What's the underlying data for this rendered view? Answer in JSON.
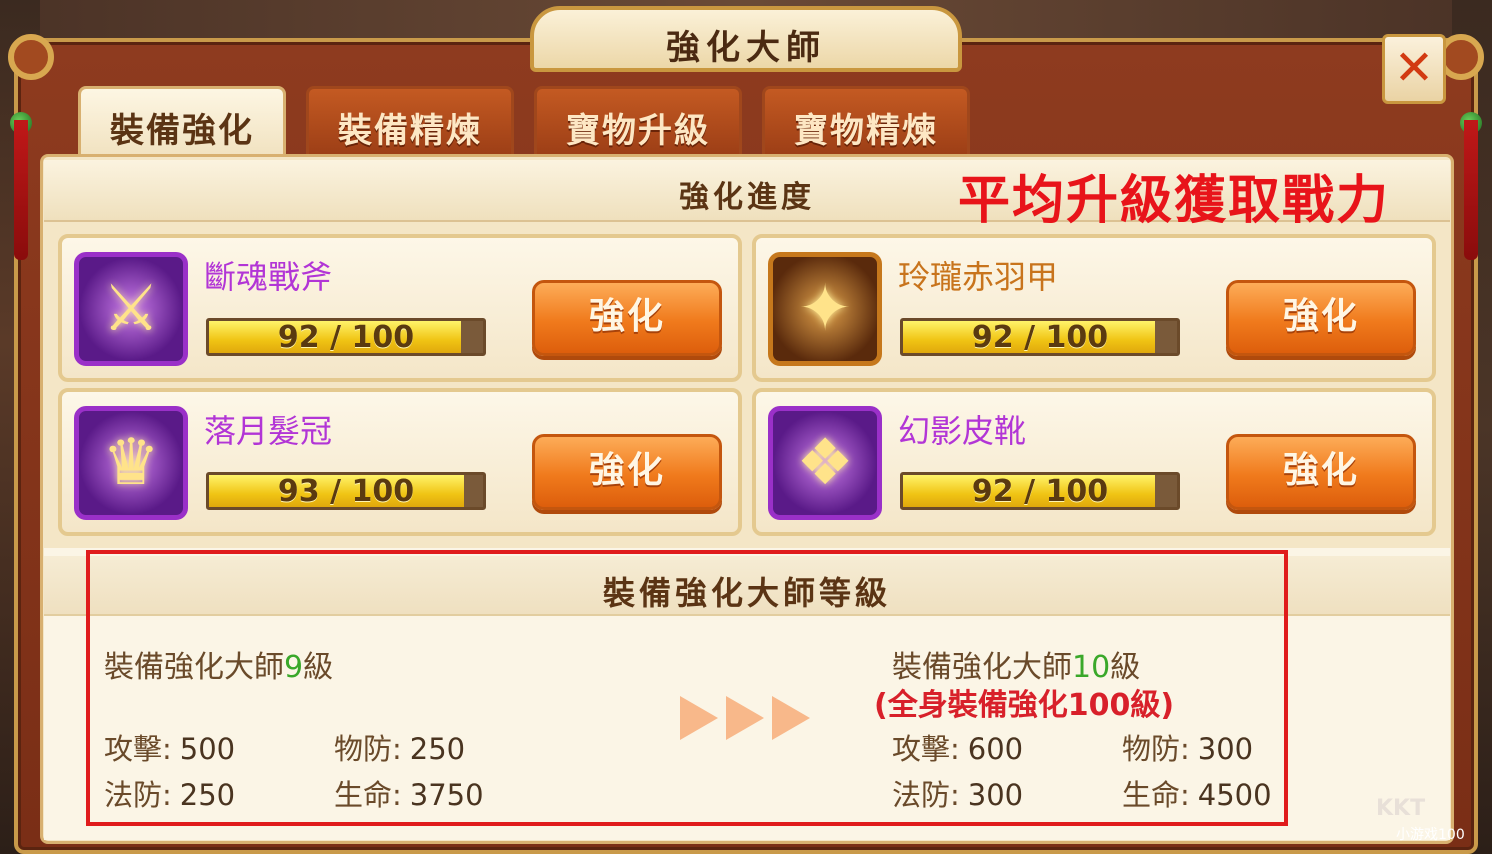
{
  "window_title": "強化大師",
  "close_label": "✕",
  "tabs": [
    {
      "label": "裝備強化",
      "active": true
    },
    {
      "label": "裝備精煉",
      "active": false
    },
    {
      "label": "寶物升級",
      "active": false
    },
    {
      "label": "寶物精煉",
      "active": false
    }
  ],
  "progress_section": {
    "title": "強化進度",
    "annotation": "平均升級獲取戰力"
  },
  "equipment": [
    {
      "name": "斷魂戰斧",
      "progress_text": "92 / 100",
      "progress": 0.92,
      "button": "強化",
      "icon": "axe-icon",
      "rarity_color": "#b235d6"
    },
    {
      "name": "玲瓏赤羽甲",
      "progress_text": "92 / 100",
      "progress": 0.92,
      "button": "強化",
      "icon": "armor-icon",
      "rarity_color": "#c8741c"
    },
    {
      "name": "落月髮冠",
      "progress_text": "93 / 100",
      "progress": 0.93,
      "button": "強化",
      "icon": "helmet-icon",
      "rarity_color": "#b235d6"
    },
    {
      "name": "幻影皮靴",
      "progress_text": "92 / 100",
      "progress": 0.92,
      "button": "強化",
      "icon": "boots-icon",
      "rarity_color": "#b235d6"
    }
  ],
  "master": {
    "title": "裝備強化大師等級",
    "current": {
      "prefix": "裝備強化大師",
      "level": "9",
      "suffix": "級",
      "stats": [
        {
          "label": "攻擊:",
          "value": "500"
        },
        {
          "label": "物防:",
          "value": "250"
        },
        {
          "label": "法防:",
          "value": "250"
        },
        {
          "label": "生命:",
          "value": "3750"
        }
      ]
    },
    "next": {
      "prefix": "裝備強化大師",
      "level": "10",
      "suffix": "級",
      "requirement": "(全身裝備強化100級)",
      "stats": [
        {
          "label": "攻擊:",
          "value": "600"
        },
        {
          "label": "物防:",
          "value": "300"
        },
        {
          "label": "法防:",
          "value": "300"
        },
        {
          "label": "生命:",
          "value": "4500"
        }
      ]
    }
  },
  "watermark": {
    "main": "KKT",
    "sub": "小游戏100"
  },
  "colors": {
    "accent_orange": "#f07a1c",
    "level_green": "#3aa82a",
    "requirement_red": "#d8202a",
    "annotation_red": "#e8141a"
  }
}
